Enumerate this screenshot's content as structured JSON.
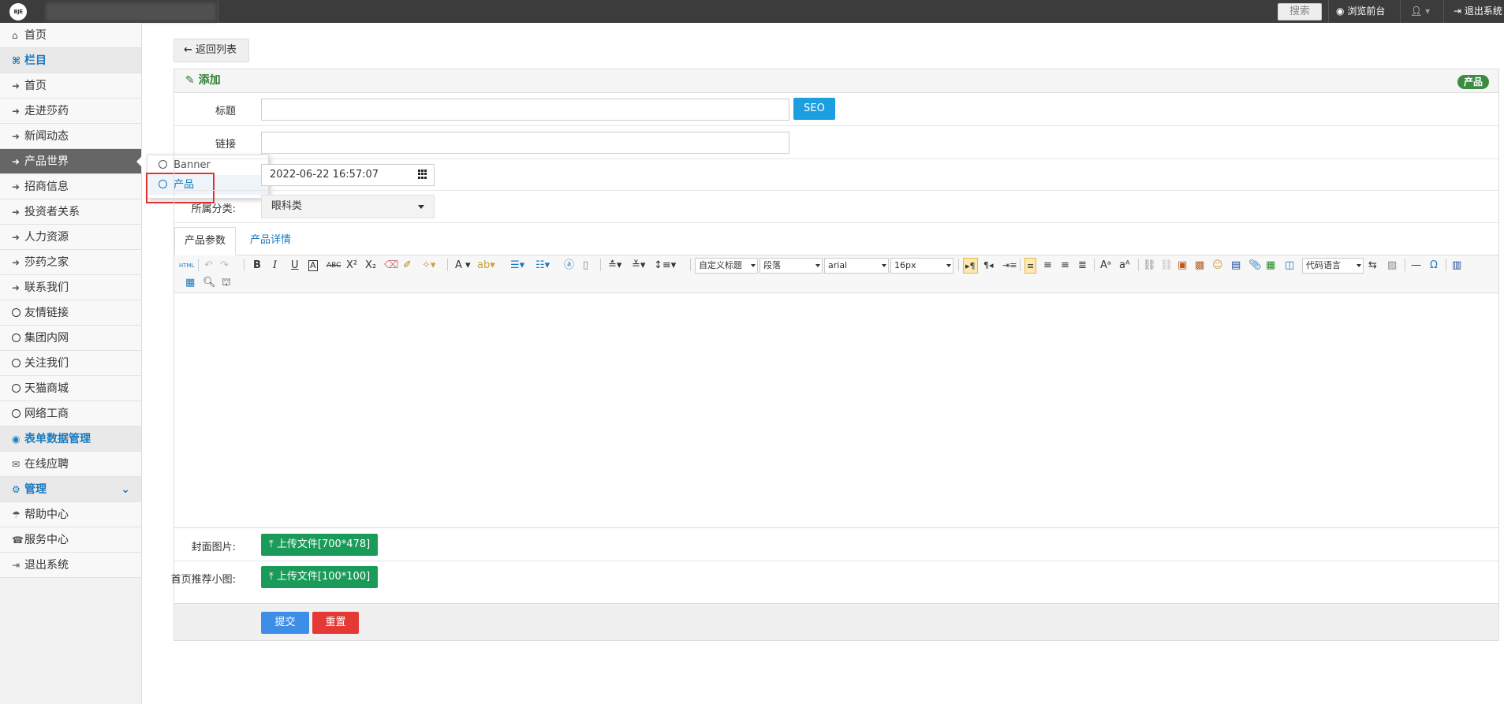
{
  "topbar": {
    "logo_text": "BJE",
    "search_label": "搜索",
    "browse_front": "浏览前台",
    "user_caret": "▾",
    "logout": "退出系统"
  },
  "sidebar": {
    "items": [
      {
        "icon": "home-icon",
        "glyph": "⌂",
        "label": "首页",
        "kind": "normal"
      },
      {
        "icon": "sitemap-icon",
        "glyph": "⌘",
        "label": "栏目",
        "kind": "head"
      },
      {
        "icon": "chevron-circle-icon",
        "glyph": "➜",
        "label": "首页",
        "kind": "normal"
      },
      {
        "icon": "chevron-circle-icon",
        "glyph": "➜",
        "label": "走进莎药",
        "kind": "normal"
      },
      {
        "icon": "chevron-circle-icon",
        "glyph": "➜",
        "label": "新闻动态",
        "kind": "normal"
      },
      {
        "icon": "chevron-circle-icon",
        "glyph": "➜",
        "label": "产品世界",
        "kind": "active"
      },
      {
        "icon": "chevron-circle-icon",
        "glyph": "➜",
        "label": "招商信息",
        "kind": "normal"
      },
      {
        "icon": "chevron-circle-icon",
        "glyph": "➜",
        "label": "投资者关系",
        "kind": "normal"
      },
      {
        "icon": "chevron-circle-icon",
        "glyph": "➜",
        "label": "人力资源",
        "kind": "normal"
      },
      {
        "icon": "chevron-circle-icon",
        "glyph": "➜",
        "label": "莎药之家",
        "kind": "normal"
      },
      {
        "icon": "chevron-circle-icon",
        "glyph": "➜",
        "label": "联系我们",
        "kind": "normal"
      },
      {
        "icon": "circle-icon",
        "glyph": "",
        "label": "友情链接",
        "kind": "circle"
      },
      {
        "icon": "circle-icon",
        "glyph": "",
        "label": "集团内网",
        "kind": "circle"
      },
      {
        "icon": "circle-icon",
        "glyph": "",
        "label": "关注我们",
        "kind": "circle"
      },
      {
        "icon": "circle-icon",
        "glyph": "",
        "label": "天猫商城",
        "kind": "circle"
      },
      {
        "icon": "circle-icon",
        "glyph": "",
        "label": "网络工商",
        "kind": "circle"
      },
      {
        "icon": "globe-icon",
        "glyph": "◉",
        "label": "表单数据管理",
        "kind": "head"
      },
      {
        "icon": "comments-icon",
        "glyph": "✉",
        "label": "在线应聘",
        "kind": "normal"
      },
      {
        "icon": "cogs-icon",
        "glyph": "⚙",
        "label": "管理",
        "kind": "head-chevron"
      },
      {
        "icon": "help-icon",
        "glyph": "☂",
        "label": "帮助中心",
        "kind": "normal"
      },
      {
        "icon": "phone-icon",
        "glyph": "☎",
        "label": "服务中心",
        "kind": "normal"
      },
      {
        "icon": "sign-out-icon",
        "glyph": "⇥",
        "label": "退出系统",
        "kind": "normal"
      }
    ]
  },
  "flyout": {
    "items": [
      {
        "label": "Banner",
        "selected": false
      },
      {
        "label": "产品",
        "selected": true
      }
    ]
  },
  "main": {
    "back_label": "返回列表",
    "panel_title": "添加",
    "panel_badge": "产品",
    "form": {
      "title_label": "标题",
      "title_value": "",
      "seo_label": "SEO",
      "link_label": "链接",
      "link_value": "",
      "date_value": "2022-06-22 16:57:07",
      "category_label": "所属分类:",
      "category_value": "眼科类"
    },
    "tabs": [
      "产品参数",
      "产品详情"
    ],
    "toolbar": {
      "heading_dd": "自定义标题",
      "paragraph_dd": "段落",
      "font_dd": "arial",
      "size_dd": "16px",
      "code_dd": "代码语言",
      "html_label": "HTML"
    },
    "cover_label": "封面图片:",
    "cover_btn": "上传文件[700*478]",
    "thumb_label": "首页推荐小图:",
    "thumb_btn": "上传文件[100*100]",
    "submit_label": "提交",
    "reset_label": "重置"
  },
  "colors": {
    "topbar": "#3c3c3c",
    "accent_blue": "#1a7abf",
    "upload_green": "#1a9b5a",
    "submit_blue": "#3d8ee6",
    "reset_red": "#e53935",
    "badge_green": "#3d8b40",
    "highlight_red": "#e03030"
  }
}
